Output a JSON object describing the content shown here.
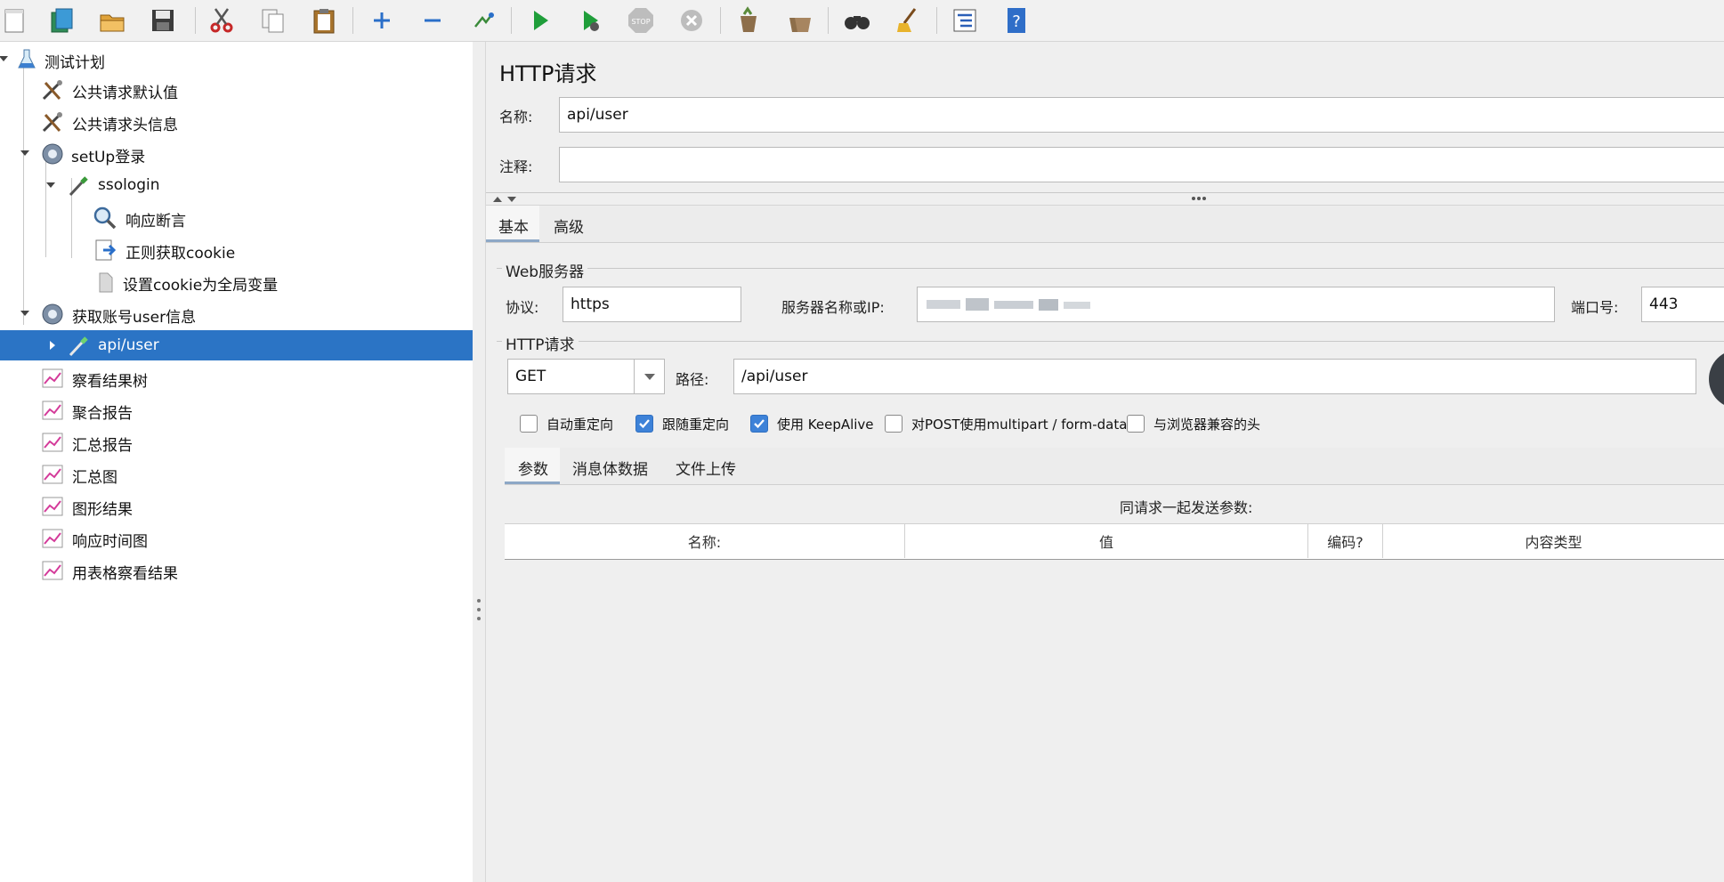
{
  "toolbar": {
    "icons": [
      "new-icon",
      "templates-icon",
      "open-icon",
      "save-icon",
      "cut-icon",
      "copy-icon",
      "paste-icon",
      "expand-icon",
      "collapse-icon",
      "toggle-icon",
      "start-icon",
      "start-no-pause-icon",
      "stop-icon",
      "shutdown-icon",
      "clear-icon",
      "clear-all-icon",
      "search-icon",
      "reset-search-icon",
      "function-helper-icon",
      "help-icon"
    ]
  },
  "tree": {
    "items": [
      {
        "label": "测试计划",
        "icon": "flask-icon"
      },
      {
        "label": "公共请求默认值",
        "icon": "tools-icon"
      },
      {
        "label": "公共请求头信息",
        "icon": "tools-icon"
      },
      {
        "label": "setUp登录",
        "icon": "gear-icon"
      },
      {
        "label": "ssologin",
        "icon": "pipette-icon"
      },
      {
        "label": "响应断言",
        "icon": "magnifier-icon"
      },
      {
        "label": "正则获取cookie",
        "icon": "extractor-icon"
      },
      {
        "label": "设置cookie为全局变量",
        "icon": "document-icon"
      },
      {
        "label": "获取账号user信息",
        "icon": "gear-icon"
      },
      {
        "label": "api/user",
        "icon": "pipette-icon"
      },
      {
        "label": "察看结果树",
        "icon": "chart-icon"
      },
      {
        "label": "聚合报告",
        "icon": "chart-icon"
      },
      {
        "label": "汇总报告",
        "icon": "chart-icon"
      },
      {
        "label": "汇总图",
        "icon": "chart-icon"
      },
      {
        "label": "图形结果",
        "icon": "chart-icon"
      },
      {
        "label": "响应时间图",
        "icon": "chart-icon"
      },
      {
        "label": "用表格察看结果",
        "icon": "chart-icon"
      }
    ]
  },
  "panel": {
    "title": "HTTP请求",
    "name_label": "名称:",
    "name_value": "api/user",
    "comment_label": "注释:",
    "comment_value": "",
    "tabs": [
      "基本",
      "高级"
    ],
    "web_server_title": "Web服务器",
    "protocol_label": "协议:",
    "protocol_value": "https",
    "server_label": "服务器名称或IP:",
    "port_label": "端口号:",
    "port_value": "443",
    "http_request_title": "HTTP请求",
    "method_value": "GET",
    "path_label": "路径:",
    "path_value": "/api/user",
    "checkboxes": [
      {
        "label": "自动重定向",
        "checked": false
      },
      {
        "label": "跟随重定向",
        "checked": true
      },
      {
        "label": "使用 KeepAlive",
        "checked": true
      },
      {
        "label": "对POST使用multipart / form-data",
        "checked": false
      },
      {
        "label": "与浏览器兼容的头",
        "checked": false
      }
    ],
    "sub_tabs": [
      "参数",
      "消息体数据",
      "文件上传"
    ],
    "params_caption": "同请求一起发送参数:",
    "table_headers": [
      "名称:",
      "值",
      "编码?",
      "内容类型"
    ]
  },
  "colors": {
    "selection": "#2b74c5",
    "panel_bg": "#efefef",
    "checkbox_checked": "#3d82d8"
  }
}
